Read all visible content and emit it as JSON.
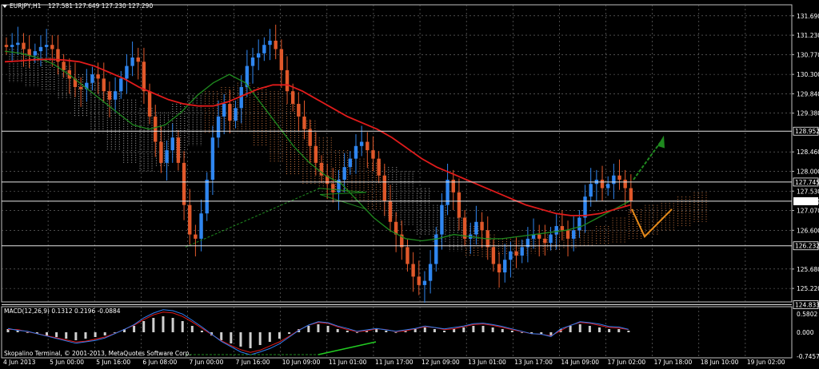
{
  "window": {
    "symbol_header": "EURJPY,H1",
    "ohlc": "127.581 127.649 127.230 127.290",
    "copyright": "Skopalino Terminal, © 2001-2013, MetaQuotes Software Corp."
  },
  "chart_data": [
    {
      "type": "candlestick",
      "symbol": "EURJPY",
      "timeframe": "H1",
      "ylim": [
        124.9,
        131.8
      ],
      "y_ticks": [
        131.69,
        131.23,
        130.77,
        130.3,
        129.84,
        129.38,
        128.46,
        128.0,
        127.53,
        127.07,
        126.6,
        125.68,
        125.22
      ],
      "x_ticks": [
        "4 Jun 2013",
        "5 Jun 00:00",
        "5 Jun 16:00",
        "6 Jun 08:00",
        "7 Jun 00:00",
        "7 Jun 16:00",
        "10 Jun 09:00",
        "11 Jun 01:00",
        "11 Jun 17:00",
        "12 Jun 09:00",
        "13 Jun 01:00",
        "13 Jun 17:00",
        "14 Jun 09:00",
        "17 Jun 02:00",
        "17 Jun 18:00",
        "18 Jun 10:00",
        "19 Jun 02:00"
      ],
      "levels": [
        {
          "value": 128.952,
          "label": "128.952"
        },
        {
          "value": 127.745,
          "label": "127.745"
        },
        {
          "value": 127.29,
          "label": "127.290",
          "highlight": true
        },
        {
          "value": 126.232,
          "label": "126.232"
        },
        {
          "value": 124.833,
          "label": "124.833"
        }
      ],
      "close_series": [
        130.95,
        131.0,
        131.05,
        130.9,
        130.75,
        130.85,
        130.95,
        131.0,
        130.9,
        130.6,
        130.4,
        130.2,
        130.0,
        129.95,
        130.1,
        130.3,
        130.2,
        129.9,
        129.7,
        129.9,
        130.2,
        130.5,
        130.7,
        130.6,
        129.9,
        129.3,
        128.7,
        128.2,
        128.5,
        128.8,
        128.2,
        127.2,
        126.5,
        126.4,
        127.0,
        127.8,
        128.8,
        129.3,
        129.6,
        129.2,
        129.5,
        130.0,
        130.5,
        130.7,
        130.8,
        131.0,
        131.1,
        130.9,
        130.4,
        129.9,
        129.6,
        129.3,
        129.0,
        128.6,
        128.2,
        127.9,
        127.7,
        127.5,
        127.8,
        128.1,
        128.3,
        128.6,
        128.7,
        128.5,
        128.3,
        127.9,
        127.3,
        126.8,
        126.5,
        126.2,
        125.8,
        125.5,
        125.3,
        125.4,
        125.8,
        126.5,
        127.2,
        127.8,
        127.5,
        126.9,
        126.4,
        126.5,
        126.8,
        126.6,
        126.2,
        125.8,
        125.6,
        125.9,
        126.1,
        126.0,
        126.2,
        126.4,
        126.5,
        126.4,
        126.3,
        126.5,
        126.7,
        126.6,
        126.4,
        126.6,
        126.9,
        127.4,
        127.7,
        127.8,
        127.6,
        127.7,
        127.9,
        127.8,
        127.6,
        127.3
      ],
      "open_series": [
        131.0,
        130.95,
        131.0,
        131.05,
        130.9,
        130.75,
        130.85,
        130.95,
        131.0,
        130.9,
        130.6,
        130.4,
        130.2,
        130.0,
        129.95,
        130.1,
        130.3,
        130.2,
        129.9,
        129.7,
        129.9,
        130.2,
        130.5,
        130.7,
        130.6,
        129.9,
        129.3,
        128.7,
        128.2,
        128.5,
        128.8,
        128.2,
        127.2,
        126.5,
        126.4,
        127.0,
        127.8,
        128.8,
        129.3,
        129.6,
        129.2,
        129.5,
        130.0,
        130.5,
        130.7,
        130.8,
        131.0,
        131.1,
        130.9,
        130.4,
        129.9,
        129.6,
        129.3,
        129.0,
        128.6,
        128.2,
        127.9,
        127.7,
        127.5,
        127.8,
        128.1,
        128.3,
        128.6,
        128.7,
        128.5,
        128.3,
        127.9,
        127.3,
        126.8,
        126.5,
        126.2,
        125.8,
        125.5,
        125.3,
        125.4,
        125.8,
        126.5,
        127.2,
        127.8,
        127.5,
        126.9,
        126.4,
        126.5,
        126.8,
        126.6,
        126.2,
        125.8,
        125.6,
        125.9,
        126.1,
        126.0,
        126.2,
        126.4,
        126.5,
        126.4,
        126.3,
        126.5,
        126.7,
        126.6,
        126.4,
        126.6,
        126.9,
        127.4,
        127.7,
        127.8,
        127.6,
        127.7,
        127.9,
        127.8,
        127.6
      ],
      "indicators": {
        "ma_slow": {
          "color": "#e01b1b",
          "values": [
            130.6,
            130.62,
            130.65,
            130.66,
            130.64,
            130.6,
            130.5,
            130.35,
            130.2,
            130.0,
            129.85,
            129.7,
            129.6,
            129.55,
            129.55,
            129.65,
            129.8,
            129.95,
            130.05,
            130.05,
            129.9,
            129.7,
            129.5,
            129.3,
            129.15,
            129.0,
            128.8,
            128.55,
            128.3,
            128.1,
            127.95,
            127.8,
            127.65,
            127.5,
            127.35,
            127.2,
            127.1,
            127.0,
            126.95,
            126.95,
            127.0,
            127.1,
            127.2
          ]
        },
        "ma_fast": {
          "color": "#1f8a1f",
          "values": [
            130.85,
            130.8,
            130.7,
            130.55,
            130.3,
            130.0,
            129.7,
            129.4,
            129.1,
            129.0,
            129.1,
            129.4,
            129.8,
            130.1,
            130.3,
            130.1,
            129.6,
            129.1,
            128.6,
            128.2,
            127.9,
            127.7,
            127.3,
            126.9,
            126.6,
            126.4,
            126.35,
            126.4,
            126.5,
            126.45,
            126.4,
            126.4,
            126.45,
            126.5,
            126.55,
            126.6,
            126.7,
            126.9,
            127.1,
            127.3
          ]
        },
        "cloud_color_bull": "#e8884a",
        "cloud_color_bear": "#cfcfcf",
        "cloud_upper": [
          130.9,
          130.8,
          130.7,
          130.5,
          130.3,
          130.1,
          129.9,
          129.7,
          129.5,
          129.4,
          129.6,
          129.8,
          129.9,
          130.0,
          130.1,
          130.0,
          129.9,
          129.6,
          129.2,
          128.8,
          128.5,
          128.3,
          128.2,
          128.1,
          128.0,
          127.6,
          127.2,
          126.9,
          126.7,
          126.5,
          126.4,
          126.35,
          126.4,
          126.5,
          126.6,
          126.6,
          126.7,
          126.9,
          127.1,
          127.2,
          127.3,
          127.4,
          127.5
        ],
        "cloud_lower": [
          130.1,
          130.0,
          129.9,
          129.7,
          129.3,
          128.9,
          128.5,
          128.2,
          128.0,
          128.1,
          128.3,
          128.6,
          128.9,
          129.0,
          128.9,
          128.6,
          128.2,
          127.9,
          127.7,
          127.6,
          127.5,
          127.3,
          127.1,
          126.9,
          126.7,
          126.5,
          126.3,
          126.1,
          126.0,
          125.95,
          126.0,
          126.0,
          126.05,
          126.1,
          126.15,
          126.2,
          126.25,
          126.3,
          126.4,
          126.5,
          126.6,
          126.7,
          126.8
        ]
      },
      "projection": {
        "up_arrow_color": "#1f8a1f",
        "down_projection_color": "#e58a1a"
      }
    },
    {
      "type": "bar",
      "title": "MACD(12,26,9) 0.1312 0.2196 -0.0884",
      "ylim": [
        -0.8,
        0.8
      ],
      "y_ticks": [
        0.5802,
        0.0,
        -0.7457
      ],
      "histogram": [
        0.1,
        0.05,
        0.0,
        -0.05,
        -0.1,
        -0.15,
        -0.2,
        -0.25,
        -0.2,
        -0.15,
        -0.1,
        0.0,
        0.1,
        0.2,
        0.35,
        0.45,
        0.5,
        0.45,
        0.35,
        0.2,
        0.05,
        -0.1,
        -0.25,
        -0.35,
        -0.45,
        -0.5,
        -0.4,
        -0.3,
        -0.2,
        -0.05,
        0.1,
        0.2,
        0.25,
        0.2,
        0.1,
        0.05,
        0.0,
        0.05,
        0.1,
        0.05,
        0.0,
        0.05,
        0.1,
        0.15,
        0.1,
        0.05,
        0.1,
        0.15,
        0.2,
        0.2,
        0.15,
        0.1,
        0.05,
        0.0,
        -0.05,
        -0.05,
        -0.1,
        0.1,
        0.2,
        0.25,
        0.2,
        0.15,
        0.1,
        0.1,
        0.05
      ],
      "signal_color": "#e01b1b",
      "macd_color": "#2f7ef0"
    }
  ]
}
